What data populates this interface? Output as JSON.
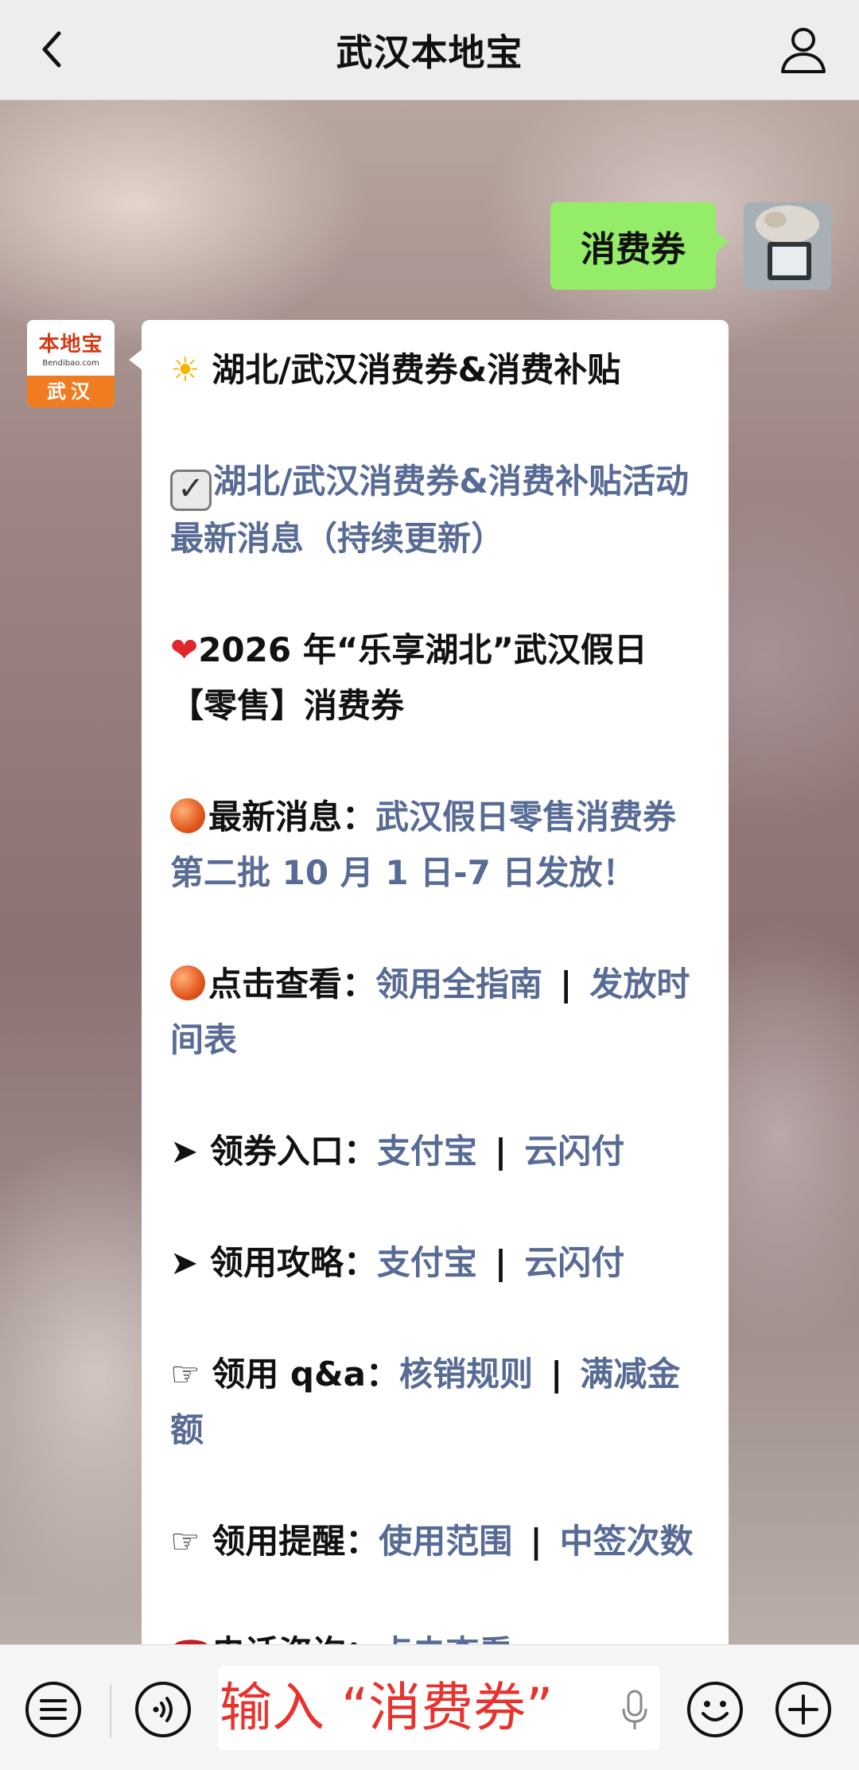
{
  "header": {
    "title": "武汉本地宝"
  },
  "outgoing_message": {
    "text": "消费券"
  },
  "bot": {
    "logo_name": "本地宝",
    "logo_domain": "Bendibao.com",
    "logo_city": "武汉"
  },
  "message": {
    "l1_text": "湖北/武汉消费券&消费补贴",
    "l2_link": "湖北/武汉消费券&消费补贴活动最新消息（持续更新）",
    "l3_text": "2026 年“乐享湖北”武汉假日【零售】消费券",
    "l4_label": "最新消息：",
    "l4_link": "武汉假日零售消费券 第二批 10 月 1 日-7 日发放！",
    "l5_label": "点击查看：",
    "l5_link1": "领用全指南",
    "l5_sep": "|",
    "l5_link2": "发放时间表",
    "l6_label": "领券入口：",
    "l6_link1": "支付宝",
    "l6_sep": "|",
    "l6_link2": "云闪付",
    "l7_label": "领用攻略：",
    "l7_link1": "支付宝",
    "l7_sep": "|",
    "l7_link2": "云闪付",
    "l8_label": "领用 q&a：",
    "l8_link1": "核销规则",
    "l8_sep": "|",
    "l8_link2": "满减金额",
    "l9_label": "领用提醒：",
    "l9_link1": "使用范围",
    "l9_sep": "|",
    "l9_link2": "中签次数",
    "l10_label": "电话咨询：",
    "l10_link": "点击查看"
  },
  "input_bar": {
    "text": "输入 “消费券”"
  },
  "icons": {
    "back": "chevron-left-icon",
    "profile": "person-icon",
    "menu": "list-menu-icon",
    "voice": "voice-icon",
    "mic": "microphone-icon",
    "emoji": "smiley-icon",
    "more": "plus-circle-icon"
  },
  "colors": {
    "link": "#576b95",
    "outgoing_bubble": "#95ec69",
    "hint_text": "#e8322d"
  }
}
